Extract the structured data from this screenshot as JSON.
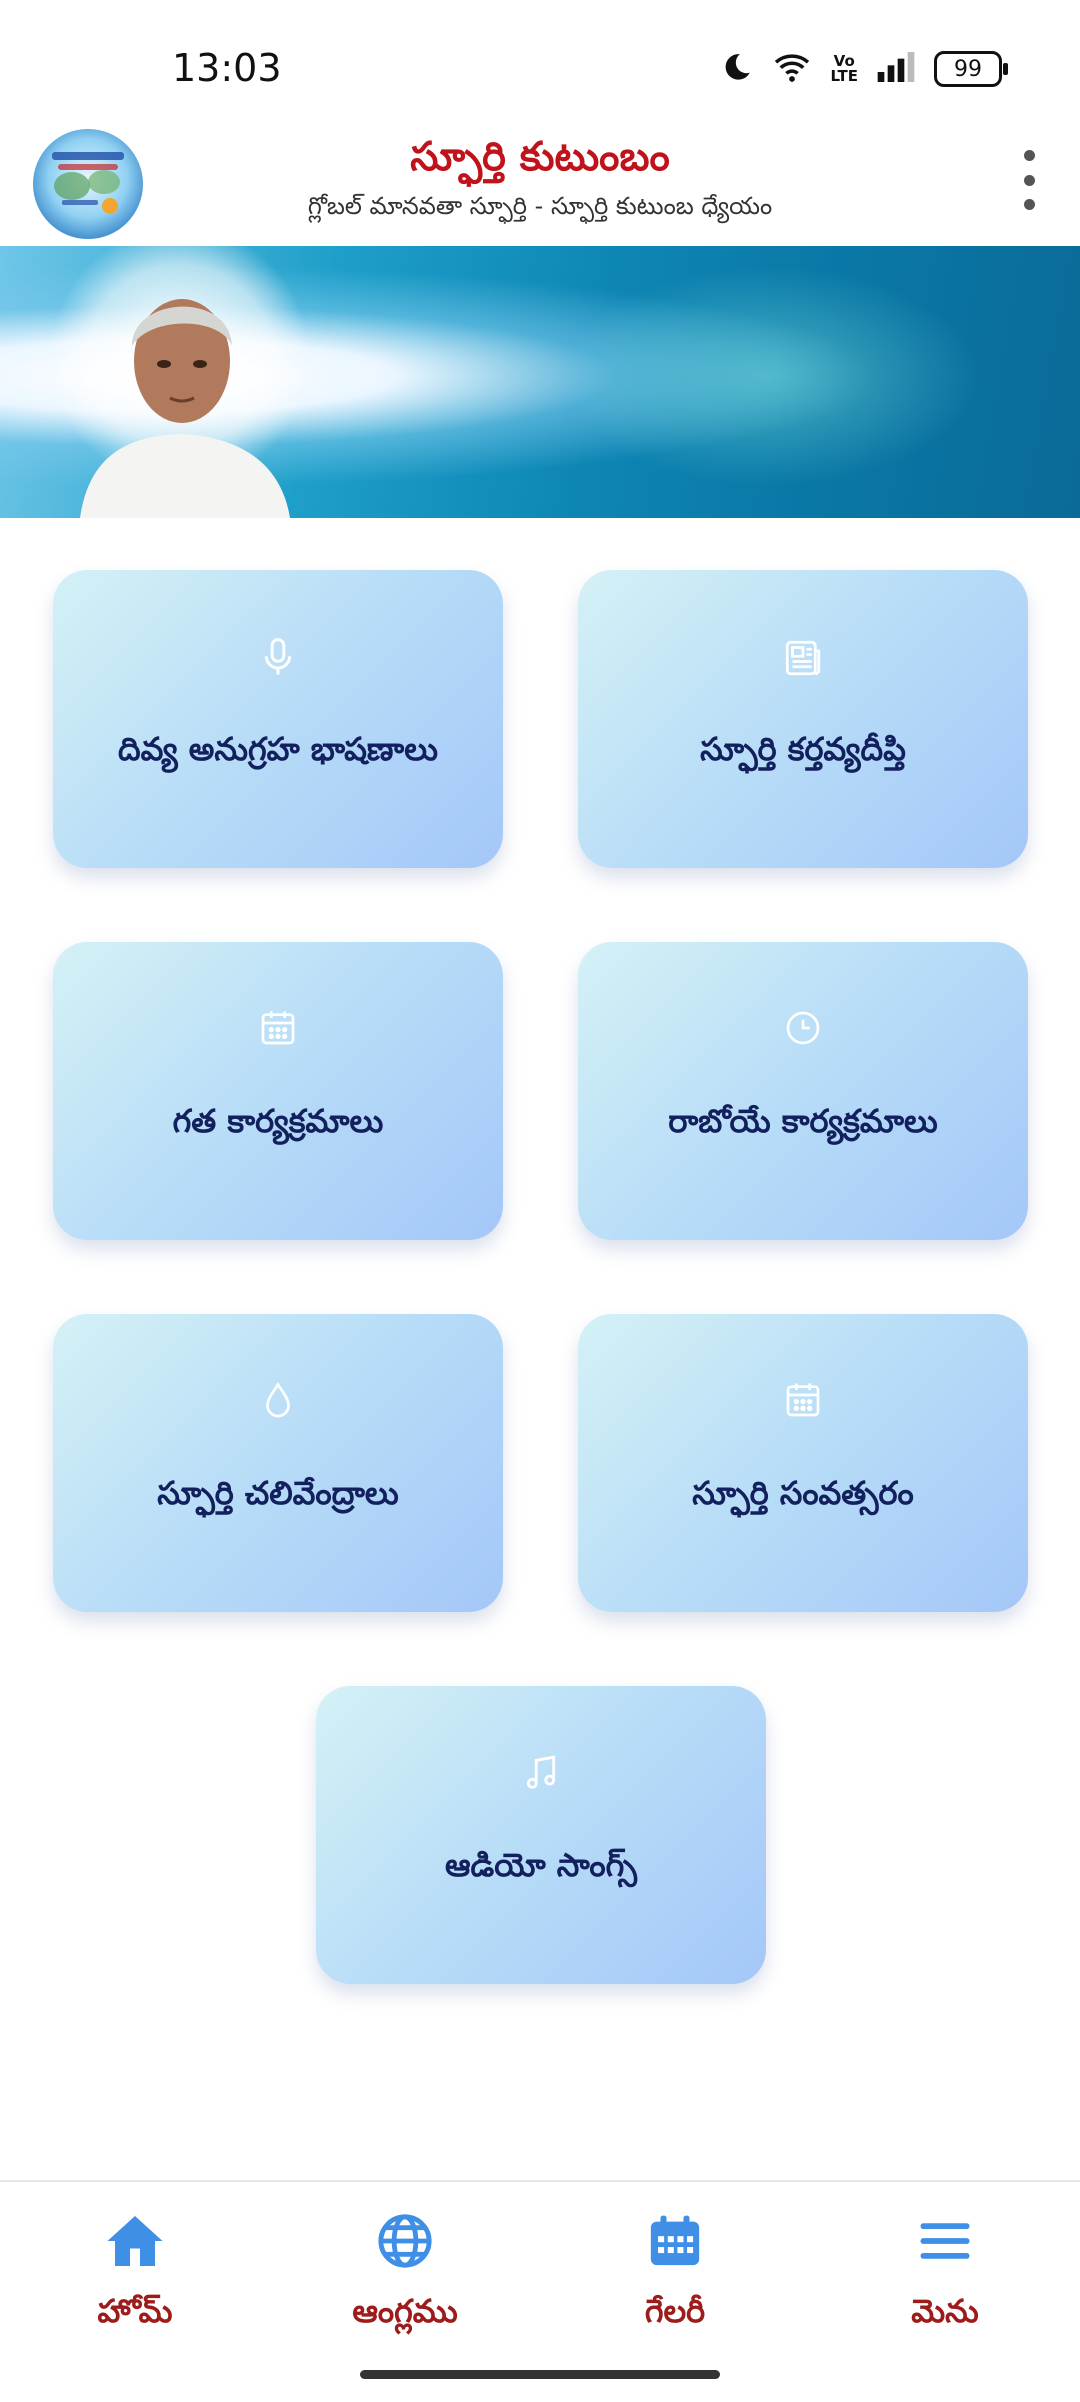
{
  "status_bar": {
    "time": "13:03",
    "battery": "99",
    "icons": [
      "moon-icon",
      "wifi-icon",
      "volte-icon",
      "signal-icon",
      "battery-icon"
    ]
  },
  "header": {
    "title": "స్ఫూర్తి కుటుంబం",
    "subtitle": "గ్లోబల్ మానవతా స్ఫూర్తి - స్ఫూర్తి కుటుంబ ధ్యేయం",
    "title_color": "#c0121b"
  },
  "cards": [
    {
      "label": "దివ్య అనుగ్రహ భాషణాలు",
      "icon": "microphone-icon"
    },
    {
      "label": "స్ఫూర్తి కర్తవ్యదీప్తి",
      "icon": "newspaper-icon"
    },
    {
      "label": "గత కార్యక్రమాలు",
      "icon": "calendar-icon"
    },
    {
      "label": "రాబోయే కార్యక్రమాలు",
      "icon": "clock-icon"
    },
    {
      "label": "స్ఫూర్తి చలివేంద్రాలు",
      "icon": "water-drop-icon"
    },
    {
      "label": "స్ఫూర్తి సంవత్సరం",
      "icon": "calendar-icon"
    },
    {
      "label": "ఆడియో సాంగ్స్",
      "icon": "music-note-icon"
    }
  ],
  "bottom_nav": [
    {
      "label": "హోమ్",
      "icon": "home-icon"
    },
    {
      "label": "ఆంగ్లము",
      "icon": "globe-icon"
    },
    {
      "label": "గేలరీ",
      "icon": "calendar-grid-icon"
    },
    {
      "label": "మెను",
      "icon": "hamburger-menu-icon"
    }
  ],
  "colors": {
    "nav_icon": "#3f8fe6",
    "nav_label": "#9e1b1b",
    "card_label": "#13205e"
  }
}
